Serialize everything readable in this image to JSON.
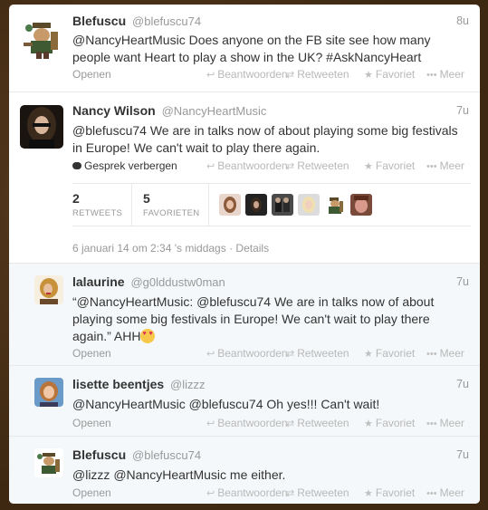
{
  "actions": {
    "reply": "Beantwoorden",
    "retweet": "Retweeten",
    "favorite": "Favoriet",
    "more": "Meer",
    "open": "Openen",
    "hide_conversation": "Gesprek verbergen"
  },
  "tweets": [
    {
      "name": "Blefuscu",
      "handle": "@blefuscu74",
      "time": "8u",
      "text_parts": [
        "@NancyHeartMusic",
        " Does anyone on the FB site see how many people want Heart to play a show in the UK? ",
        "#AskNancyHeart"
      ]
    },
    {
      "name": "Nancy Wilson",
      "handle": "@NancyHeartMusic",
      "time": "7u",
      "text_parts": [
        "@blefuscu74",
        " We are in talks now of about playing some big festivals in Europe! We can't wait to play there again."
      ],
      "retweets_count": "2",
      "retweets_label": "RETWEETS",
      "favorites_count": "5",
      "favorites_label": "FAVORIETEN",
      "date": "6 januari 14 om 2:34 's middags",
      "details_label": "Details"
    },
    {
      "name": "lalaurine",
      "handle": "@g0lddustw0man",
      "time": "7u",
      "text_parts": [
        "“",
        "@NancyHeartMusic",
        ": ",
        "@blefuscu74",
        " We are in talks now of about playing some big festivals in Europe! We can't wait to play there again.” AHH"
      ]
    },
    {
      "name": "lisette beentjes",
      "handle": "@lizzz",
      "time": "7u",
      "text_parts": [
        "@NancyHeartMusic",
        " ",
        "@blefuscu74",
        " Oh yes!!! Can't wait!"
      ]
    },
    {
      "name": "Blefuscu",
      "handle": "@blefuscu74",
      "time": "7u",
      "text_parts": [
        "@lizzz",
        " ",
        "@NancyHeartMusic",
        " me either."
      ]
    }
  ],
  "colors": {
    "background": "#4a3219",
    "card": "#ffffff",
    "reply_bg": "#f5f8fa",
    "name": "#333333",
    "muted": "#999999"
  }
}
